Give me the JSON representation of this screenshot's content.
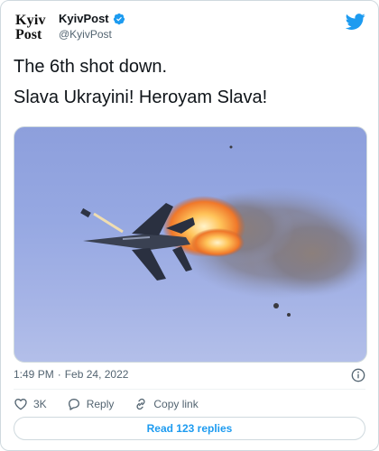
{
  "colors": {
    "accent": "#1d9bf0",
    "text": "#0f1419",
    "muted": "#536471",
    "border": "#cfd9de"
  },
  "author": {
    "logo_line1": "Kyiv",
    "logo_line2": "Post",
    "name": "KyivPost",
    "handle": "@KyivPost",
    "verified": true
  },
  "tweet": {
    "line1": "The 6th shot down.",
    "line2": "Slava Ukrayini! Heroyam Slava!",
    "time": "1:49 PM",
    "separator": "·",
    "date": "Feb 24, 2022"
  },
  "actions": {
    "likes": "3K",
    "reply_label": "Reply",
    "copy_label": "Copy link"
  },
  "replies_button": "Read 123 replies",
  "icons": [
    "twitter-bird-icon",
    "verified-badge-icon",
    "info-icon",
    "heart-icon",
    "reply-icon",
    "link-icon"
  ]
}
